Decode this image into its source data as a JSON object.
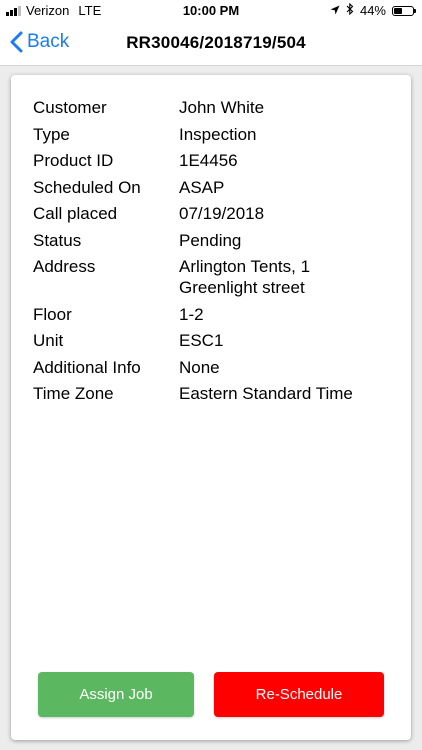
{
  "status_bar": {
    "carrier": "Verizon",
    "network": "LTE",
    "time": "10:00 PM",
    "battery_text": "44%",
    "battery_level": 0.44
  },
  "nav": {
    "back_label": "Back",
    "title": "RR30046/2018719/504"
  },
  "details": {
    "customer": {
      "label": "Customer",
      "value": "John White"
    },
    "type": {
      "label": "Type",
      "value": "Inspection"
    },
    "product_id": {
      "label": "Product ID",
      "value": "1E4456"
    },
    "scheduled_on": {
      "label": "Scheduled On",
      "value": "ASAP"
    },
    "call_placed": {
      "label": "Call placed",
      "value": "07/19/2018"
    },
    "status": {
      "label": "Status",
      "value": "Pending"
    },
    "address": {
      "label": "Address",
      "value_line1": "Arlington Tents, 1",
      "value_line2": "Greenlight street"
    },
    "floor": {
      "label": "Floor",
      "value": "1-2"
    },
    "unit": {
      "label": "Unit",
      "value": "ESC1"
    },
    "additional_info": {
      "label": "Additional Info",
      "value": "None"
    },
    "time_zone": {
      "label": "Time Zone",
      "value": "Eastern Standard Time"
    }
  },
  "actions": {
    "assign_label": "Assign Job",
    "reschedule_label": "Re-Schedule"
  },
  "colors": {
    "accent": "#1a7cf3",
    "assign": "#5cb860",
    "reschedule": "#ff0000"
  },
  "icons": {
    "signal": "cellular-signal-icon",
    "location": "location-arrow-icon",
    "bluetooth": "bluetooth-icon",
    "battery": "battery-icon",
    "back": "chevron-left-icon"
  }
}
